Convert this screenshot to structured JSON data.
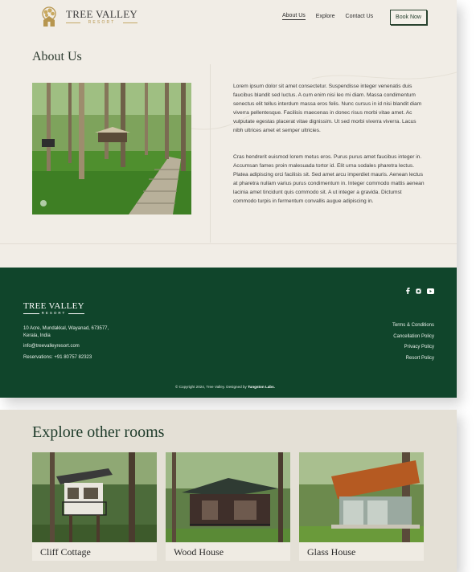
{
  "header": {
    "brand_name": "TREE VALLEY",
    "brand_sub": "RESORT",
    "nav": [
      "About Us",
      "Explore",
      "Contact Us"
    ],
    "book_label": "Book Now"
  },
  "about": {
    "title": "About Us",
    "para1": "Lorem ipsum dolor sit amet consectetur. Suspendisse integer venenatis duis faucibus blandit sed luctus. A cum enim nisi leo mi diam. Massa condimentum senectus elit tellus interdum massa eros felis. Nunc cursus in id nisi blandit diam viverra pellentesque. Facilisis maecenas in donec risus morbi vitae amet. Ac vulputate egestas placerat vitae dignissim. Ut sed morbi viverra viverra. Lacus nibh ultrices amet et semper ultricies.",
    "para2": "Cras hendrerit euismod lorem metus eros. Purus purus amet faucibus integer in. Accumsan fames proin malesuada tortor id. Elit urna sodales pharetra lectus. Platea adipiscing orci facilisis sit. Sed amet arcu imperdiet mauris. Aenean lectus at pharetra nullam varius purus condimentum in. Integer commodo mattis aenean lacinia amet tincidunt quis commodo sit. A ut integer a gravida. Dictumst commodo turpis in fermentum convallis augue adipiscing in."
  },
  "footer": {
    "brand_name": "TREE VALLEY",
    "brand_sub": "RESORT",
    "address": "10 Acre, Mundakkal, Wayanad, 673577, Kerala, India",
    "email": "info@treevalleyresort.com",
    "phone": "Reservations: +91 80757 82323",
    "links": [
      "Terms & Conditions",
      "Cancellation Policy",
      "Privacy Policy",
      "Resort Policy"
    ],
    "social_icons": [
      "facebook-icon",
      "instagram-icon",
      "youtube-icon"
    ],
    "copyright": "© Copyright 2024, Tree Valley. Designed by",
    "designer": "Tungston Labs."
  },
  "rooms": {
    "title": "Explore other rooms",
    "cards": [
      {
        "label": "Cliff Cottage"
      },
      {
        "label": "Wood House"
      },
      {
        "label": "Glass House"
      }
    ]
  },
  "colors": {
    "background": "#f1ede6",
    "footer": "#10452b",
    "accent_gold": "#b7964f",
    "heading_green": "#1e3b2a"
  }
}
